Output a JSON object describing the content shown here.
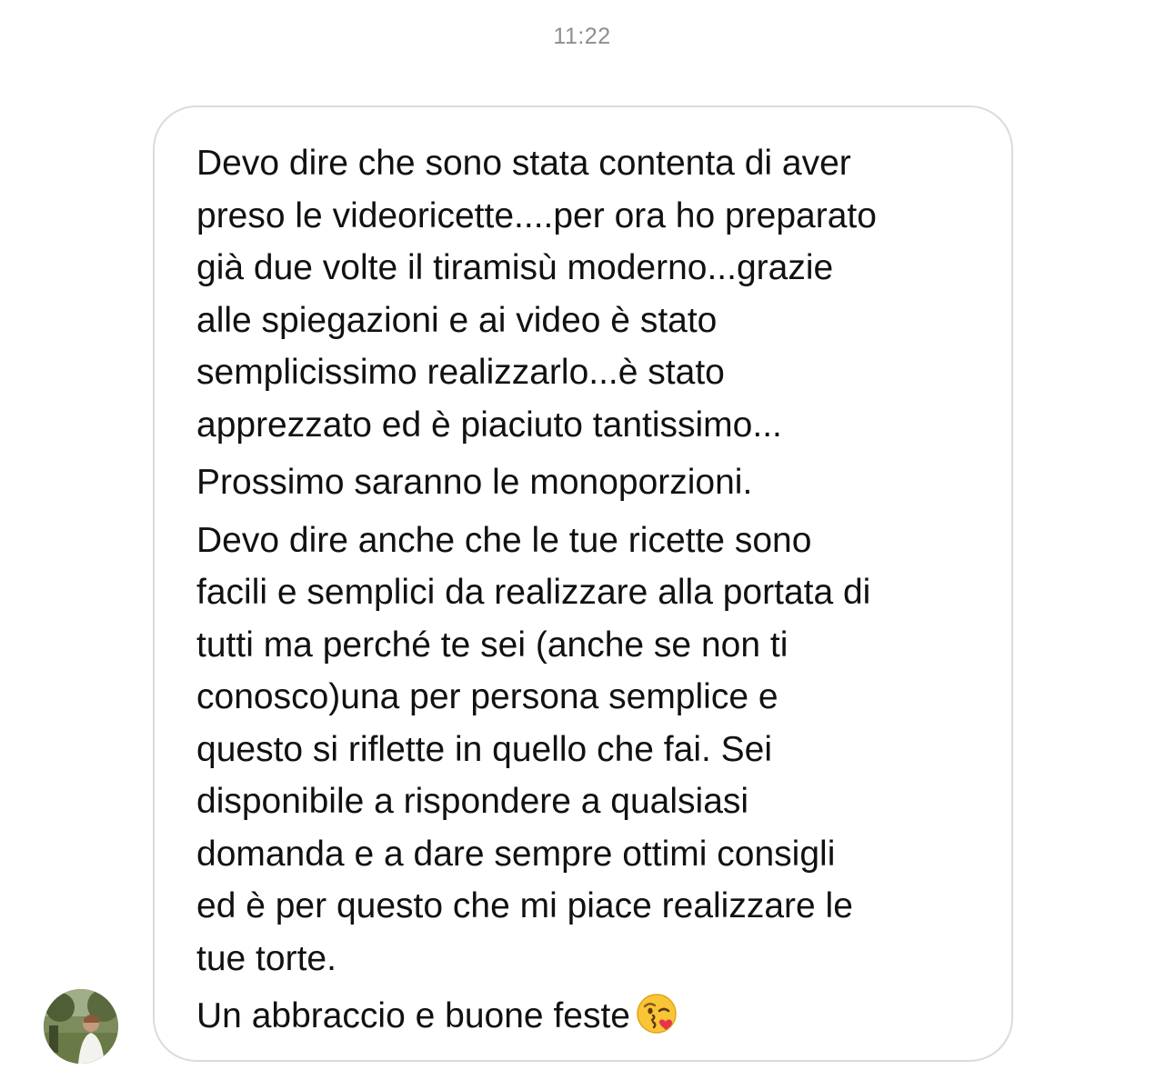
{
  "header": {
    "timestamp": "11:22"
  },
  "sender": {
    "avatar_icon": "user-avatar-photo"
  },
  "message": {
    "paragraphs": [
      {
        "lines": [
          "Devo dire che sono stata contenta di aver",
          "preso le videoricette....per ora ho preparato",
          "già due volte il tiramisù moderno...grazie",
          "alle spiegazioni e ai video è stato",
          "semplicissimo realizzarlo...è stato",
          "apprezzato ed è piaciuto tantissimo..."
        ]
      },
      {
        "lines": [
          "Prossimo saranno le monoporzioni."
        ]
      },
      {
        "lines": [
          "Devo dire anche che le tue ricette sono",
          "facili e semplici da realizzare alla portata di",
          "tutti ma perché te sei (anche se non ti",
          "conosco)una per persona semplice e",
          "questo si riflette in quello che fai. Sei",
          "disponibile a rispondere a qualsiasi",
          "domanda e a dare sempre ottimi consigli",
          "ed è per questo che mi piace realizzare le",
          "tue torte."
        ]
      },
      {
        "lines": [
          "Un abbraccio e buone feste"
        ]
      }
    ],
    "emoji_icon": "kissing-face-emoji-icon"
  },
  "colors": {
    "bubble_border": "#dbdbdb",
    "text": "#111111",
    "timestamp": "#8e8e93"
  }
}
